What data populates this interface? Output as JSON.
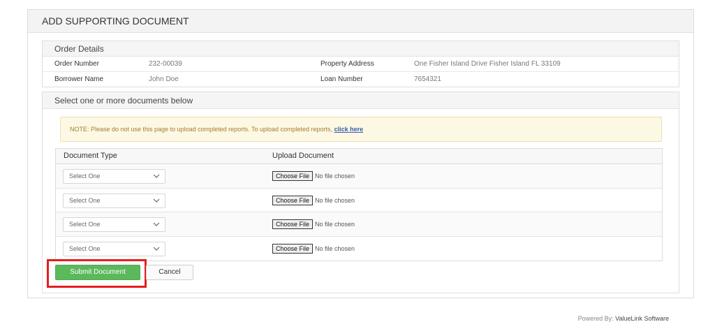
{
  "panel": {
    "title": "ADD SUPPORTING DOCUMENT"
  },
  "order_details": {
    "title": "Order Details",
    "rows": [
      {
        "label1": "Order Number",
        "value1": "232-00039",
        "label2": "Property Address",
        "value2": "One Fisher Island Drive Fisher Island FL 33109"
      },
      {
        "label1": "Borrower Name",
        "value1": "John Doe",
        "label2": "Loan Number",
        "value2": "7654321"
      }
    ]
  },
  "documents": {
    "title": "Select one or more documents below",
    "note_text": "NOTE: Please do not use this page to upload completed reports. To upload completed reports, ",
    "note_link": "click here",
    "col_type": "Document Type",
    "col_upload": "Upload Document",
    "rows": [
      {
        "select_value": "Select One",
        "choose_label": "Choose File",
        "file_status": "No file chosen"
      },
      {
        "select_value": "Select One",
        "choose_label": "Choose File",
        "file_status": "No file chosen"
      },
      {
        "select_value": "Select One",
        "choose_label": "Choose File",
        "file_status": "No file chosen"
      },
      {
        "select_value": "Select One",
        "choose_label": "Choose File",
        "file_status": "No file chosen"
      }
    ]
  },
  "actions": {
    "submit_label": "Submit Document",
    "cancel_label": "Cancel"
  },
  "footer": {
    "prefix": "Powered By: ",
    "brand": "ValueLink Software"
  },
  "colors": {
    "submit_bg": "#5cb85c",
    "highlight": "#e61e1e",
    "note_bg": "#fcf8e3"
  }
}
